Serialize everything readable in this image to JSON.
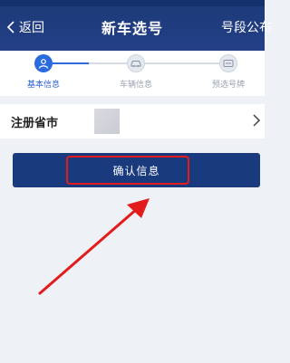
{
  "header": {
    "back_label": "返回",
    "title": "新车选号",
    "right_link": "号段公布"
  },
  "steps": [
    {
      "label": "基本信息",
      "state": "active",
      "icon": "person-icon"
    },
    {
      "label": "车辆信息",
      "state": "inactive",
      "icon": "car-icon"
    },
    {
      "label": "预选号牌",
      "state": "inactive",
      "icon": "license-plate-icon"
    }
  ],
  "province": {
    "label": "注册省市"
  },
  "confirm_button": {
    "label": "确认信息"
  },
  "colors": {
    "header_bg": "#1c3a78",
    "active_step": "#2b6be0",
    "button_bg": "#1a3a7e",
    "highlight": "#e21c1c"
  }
}
